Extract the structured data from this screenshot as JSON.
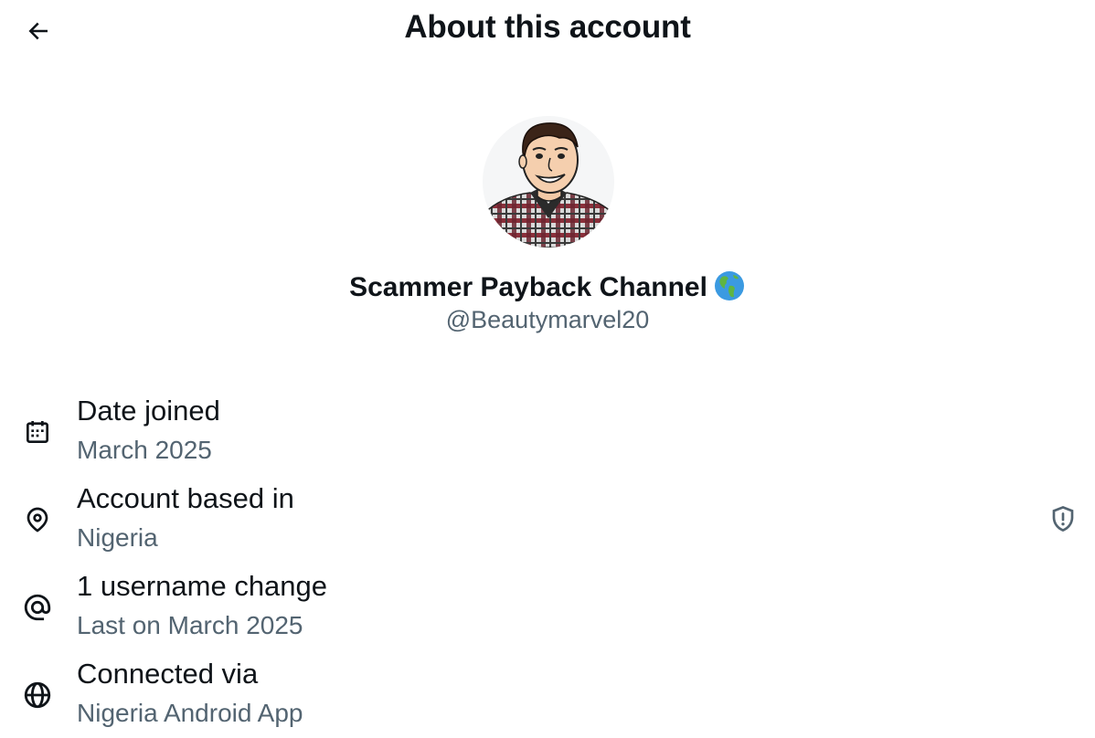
{
  "header": {
    "title": "About this account",
    "back_icon": "arrow-left-icon"
  },
  "profile": {
    "display_name": "Scammer Payback Channel",
    "name_emoji": "globe-americas-emoji",
    "handle": "@Beautymarvel20"
  },
  "details": [
    {
      "icon": "calendar-icon",
      "title": "Date joined",
      "value": "March 2025"
    },
    {
      "icon": "location-pin-icon",
      "title": "Account based in",
      "value": "Nigeria",
      "action_icon": "shield-alert-icon"
    },
    {
      "icon": "at-sign-icon",
      "title": "1 username change",
      "value": "Last on March 2025"
    },
    {
      "icon": "globe-icon",
      "title": "Connected via",
      "value": "Nigeria Android App"
    }
  ],
  "colors": {
    "text_primary": "#0f1419",
    "text_secondary": "#536471",
    "background": "#ffffff"
  }
}
